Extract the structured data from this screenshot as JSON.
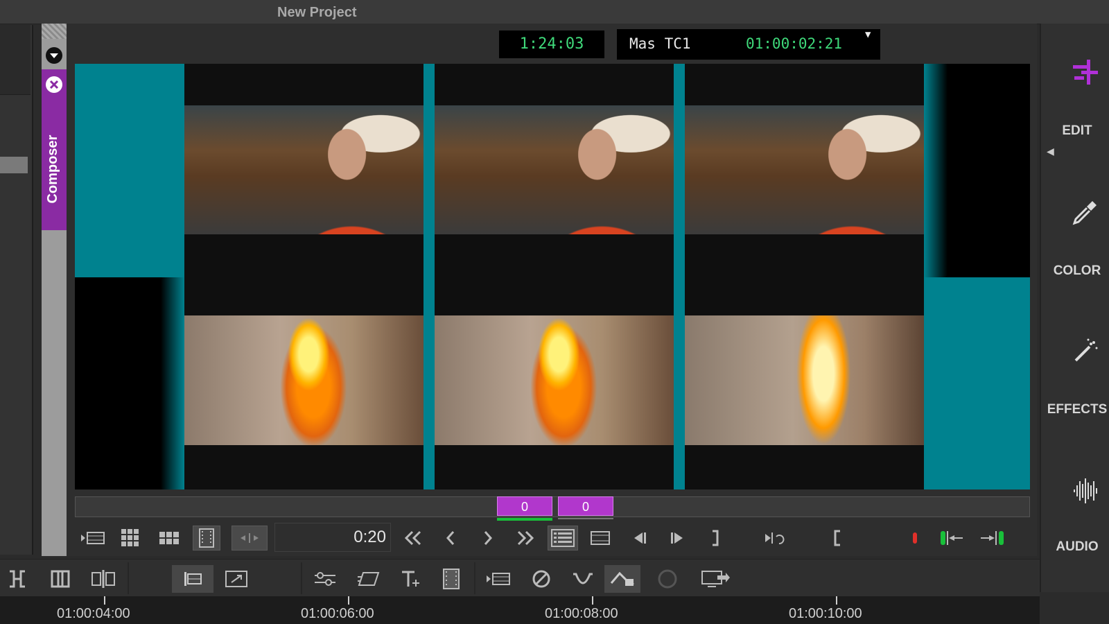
{
  "window": {
    "title": "New Project"
  },
  "composer": {
    "tab_label": "Composer",
    "timecode_left": "1:24:03",
    "tc_track_label": "Mas  TC1",
    "tc_track_value": "01:00:02:21",
    "dropdown_glyph": "▼"
  },
  "scrubber": {
    "in_count": "0",
    "out_count": "0"
  },
  "transport": {
    "duration": "0:20"
  },
  "right_rail": {
    "items": [
      {
        "label": "EDIT",
        "icon": "edit-timeline-icon",
        "color": "#b030d8"
      },
      {
        "label": "COLOR",
        "icon": "eyedropper-icon"
      },
      {
        "label": "EFFECTS",
        "icon": "magic-wand-icon"
      },
      {
        "label": "AUDIO",
        "icon": "audio-waveform-icon"
      }
    ]
  },
  "ruler": {
    "labels": [
      "01:00:04:00",
      "01:00:06:00",
      "01:00:08:00",
      "01:00:10:00"
    ]
  },
  "colors": {
    "accent": "#b137cc",
    "teal": "#00828f",
    "timecode": "#3fd97a",
    "in_mark": "#19c03a",
    "record": "#e0302a"
  }
}
